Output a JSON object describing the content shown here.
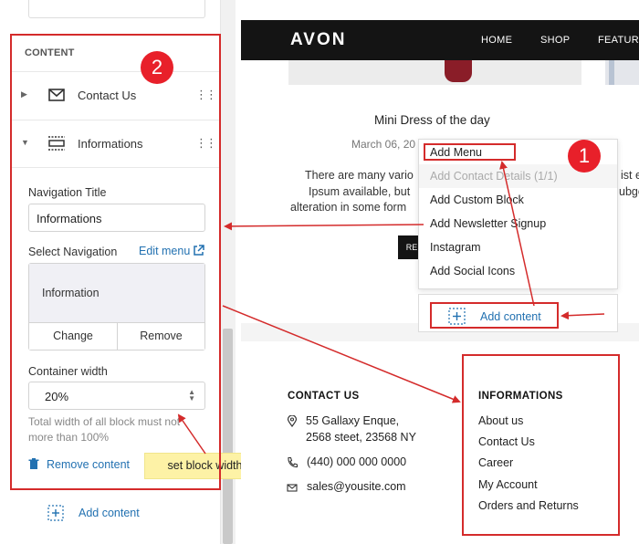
{
  "left_panel": {
    "section_heading": "CONTENT",
    "rows": [
      {
        "label": "Contact Us",
        "icon": "envelope-icon"
      },
      {
        "label": "Informations",
        "icon": "menu-block-icon"
      }
    ],
    "navigation_title": {
      "label": "Navigation Title",
      "value": "Informations"
    },
    "select_navigation": {
      "label": "Select Navigation",
      "edit_link": "Edit menu",
      "selected_menu": "Information",
      "change_label": "Change",
      "remove_label": "Remove"
    },
    "container_width": {
      "label": "Container width",
      "value": "20%",
      "helper": "Total width of all block must not more than 100%"
    },
    "remove_content_label": "Remove content",
    "add_content_label": "Add content"
  },
  "annotations": {
    "badge_1": "1",
    "badge_2": "2",
    "tooltip": "set block width"
  },
  "preview": {
    "brand": "AVON",
    "nav": [
      "HOME",
      "SHOP",
      "FEATURES"
    ],
    "post": {
      "title": "Mini Dress of the day",
      "date": "March 06, 20",
      "excerpt": [
        "There are many vario",
        "Ipsum available, but",
        "alteration in some form"
      ],
      "excerpt_right": [
        "ist e",
        "ubge"
      ],
      "read_more": "RE"
    },
    "dropdown": [
      {
        "label": "Add Menu",
        "disabled": false
      },
      {
        "label": "Add Contact Details (1/1)",
        "disabled": true
      },
      {
        "label": "Add Custom Block",
        "disabled": false
      },
      {
        "label": "Add Newsletter Signup",
        "disabled": false
      },
      {
        "label": "Instagram",
        "disabled": false
      },
      {
        "label": "Add Social Icons",
        "disabled": false
      }
    ],
    "add_content_label": "Add content",
    "contact": {
      "heading": "CONTACT US",
      "address_line1": "55 Gallaxy Enque,",
      "address_line2": "2568 steet, 23568 NY",
      "phone": "(440) 000 000 0000",
      "email": "sales@yousite.com"
    },
    "informations": {
      "heading": "INFORMATIONS",
      "links": [
        "About us",
        "Contact Us",
        "Career",
        "My Account",
        "Orders and Returns"
      ]
    }
  },
  "colors": {
    "accent_link": "#2271b1",
    "annotation_red": "#d42b2b",
    "badge_red": "#e8202a",
    "header_dark": "#141414"
  }
}
